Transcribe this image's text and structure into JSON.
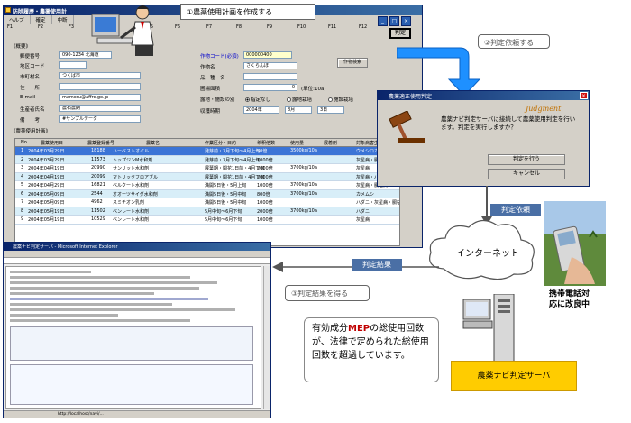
{
  "main_window": {
    "title": "防除履歴・農薬使用計",
    "menu": [
      "ヘルプ",
      "確定",
      "中断",
      "",
      "",
      ""
    ],
    "fkeys": [
      "F1",
      "F2",
      "F3",
      "F4",
      "F5",
      "F6",
      "F7",
      "F8",
      "F9",
      "F10",
      "F11",
      "F12"
    ],
    "judge_label": "判定",
    "section_summary": "《概要》",
    "fields": {
      "postal_label": "郵便番号",
      "postal_value": "090-1234 北海道",
      "address_label": "地区コード",
      "city_label": "市町村名",
      "city_value": "つくば市",
      "addr_label": "住　　所",
      "email_label": "E-mail",
      "email_value": "mamoru@affrc.go.jp",
      "producer_label": "生産者氏名",
      "producer_value": "農石農朗",
      "note_label": "備　　考",
      "note_value": "#サンプルデータ",
      "crop_code_label": "作物コード(必須)",
      "crop_code_value": "000000400",
      "crop_name_label": "作物名",
      "crop_name_value": "さくらんぼ",
      "variety_label": "品　種　名",
      "area_label": "圃場面積",
      "area_value": "0",
      "area_unit": "(単位:10a)",
      "cultivation_label": "露地・施設の別",
      "radio_1": "指定なし",
      "radio_2": "露地栽培",
      "radio_3": "施設栽培",
      "harvest_label": "収穫時期",
      "harvest_year": "2004年",
      "harvest_month": "8月",
      "harvest_day": "3日",
      "crop_search_btn": "作物検索"
    },
    "section_history": "《農薬使用計画》",
    "table": {
      "headers": [
        "No.",
        "農薬使用日",
        "農薬登録番号",
        "農薬名",
        "作業区分・目的",
        "希釈倍数",
        "使用量",
        "展着剤",
        "対象病害虫"
      ],
      "rows": [
        [
          "1",
          "2004年03月29日",
          "18188",
          "ハーベストオイル",
          "発芽前・3月下旬～4月上旬",
          "50倍",
          "3500kg/10a",
          "",
          "ウメシロカイガラム"
        ],
        [
          "2",
          "2004年03月29日",
          "11573",
          "トップジンM水和剤",
          "発芽前・3月下旬～4月上旬",
          "1000倍",
          "",
          "",
          "灰星病・胴枯病"
        ],
        [
          "3",
          "2004年04月19日",
          "20990",
          "サンリット水和剤",
          "展葉期・開花1日前・4月下旬",
          "2000倍",
          "3700kg/10a",
          "",
          "灰星病"
        ],
        [
          "4",
          "2004年04月19日",
          "20099",
          "マトリックフロアブル",
          "展葉期・開花1日前・4月下旬",
          "2000倍",
          "",
          "",
          "灰星病・ハマキム"
        ],
        [
          "5",
          "2004年04月29日",
          "16821",
          "ベルクート水和剤",
          "満開5日後・5月上旬",
          "1000倍",
          "3700kg/10a",
          "",
          "灰星病・胴枯病"
        ],
        [
          "6",
          "2004年05月09日",
          "2544",
          "オオーツサイダ水和剤",
          "満開5日後・5月中旬",
          "800倍",
          "3700kg/10a",
          "",
          "カメムシ"
        ],
        [
          "7",
          "2004年05月09日",
          "4962",
          "スミチオン乳剤",
          "満開5日後・5月中旬",
          "1000倍",
          "",
          "",
          "ハダニ・灰星病・胴枯病"
        ],
        [
          "8",
          "2004年05月19日",
          "11502",
          "ベンレート水和剤",
          "5月中旬～6月下旬",
          "2000倍",
          "3700kg/10a",
          "",
          "ハダニ"
        ],
        [
          "9",
          "2004年05月19日",
          "10529",
          "ベンレート水和剤",
          "5月中旬～6月下旬",
          "1000倍",
          "",
          "",
          "灰星病"
        ]
      ]
    }
  },
  "callouts": {
    "create_plan": "①農薬使用計画を作成する",
    "request": "②判定依頼する",
    "result_get": "③判定結果を得る",
    "request_label": "判定依頼",
    "result_label": "判定結果",
    "internet": "インターネット",
    "mobile": "携帯電話対\n応に改良中",
    "server": "農薬ナビ判定サーバ"
  },
  "dialog": {
    "title": "農薬適正使用判定",
    "logo": "Judgment",
    "message": "農薬ナビ判定サーバに接続して農薬使用判定を行います。判定を実行しますか？",
    "run_btn": "判定を行う",
    "cancel_btn": "キャンセル"
  },
  "browser": {
    "title": "農薬ナビ判定サーバ - Microsoft Internet Explorer",
    "status_url": "http://localhost/navi/..."
  },
  "note": {
    "prefix": "有効成分",
    "highlight": "MEP",
    "suffix": "の総使用回数が、法律で定められた総使用回数を超過しています。"
  },
  "colors": {
    "window_blue": "#0a246a",
    "selected_row": "#3b74d6",
    "server_yellow": "#ffcc00",
    "arrow_blue": "#1e90ff"
  }
}
